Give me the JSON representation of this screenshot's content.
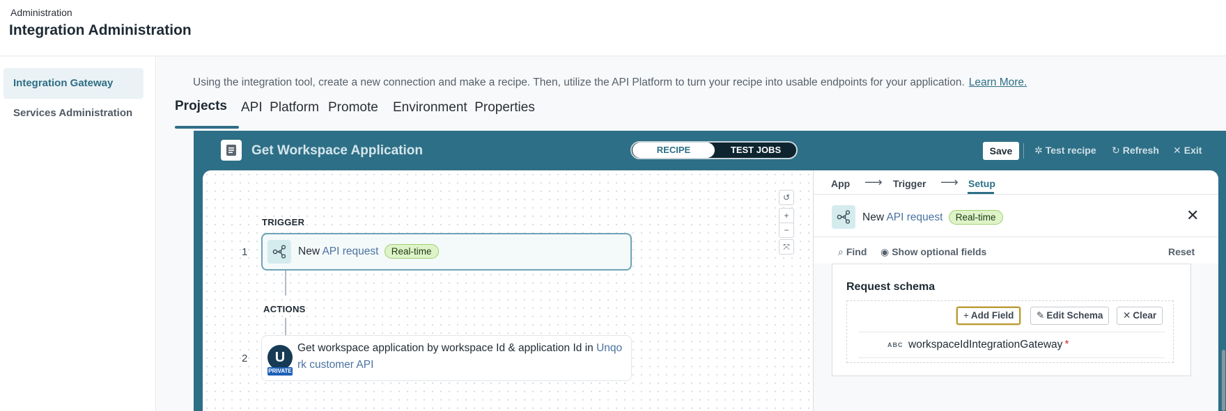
{
  "header": {
    "breadcrumb": "Administration",
    "title": "Integration Administration"
  },
  "sidebar": {
    "items": [
      {
        "label": "Integration Gateway",
        "active": true
      },
      {
        "label": "Services Administration",
        "active": false
      }
    ]
  },
  "main": {
    "info_text": "Using the integration tool, create a new connection and make a recipe. Then, utilize the API Platform to turn your recipe into usable endpoints for your application.",
    "learn_more": "Learn More.",
    "tabs": [
      {
        "label": "Projects",
        "active": true
      },
      {
        "label": "API  Platform",
        "active": false
      },
      {
        "label": "Promote",
        "active": false
      },
      {
        "label": "Environment  Properties",
        "active": false
      }
    ]
  },
  "recipe": {
    "title": "Get Workspace Application",
    "toggle": {
      "recipe": "RECIPE",
      "test_jobs": "TEST JOBS"
    },
    "actions": {
      "save": "Save",
      "test_recipe": "Test recipe",
      "refresh": "Refresh",
      "exit": "Exit"
    }
  },
  "canvas": {
    "trigger_label": "TRIGGER",
    "actions_label": "ACTIONS",
    "steps": [
      {
        "num": "1",
        "prefix": "New",
        "link": "API request",
        "badge": "Real-time"
      },
      {
        "num": "2",
        "text": "Get workspace application by workspace Id & application Id in",
        "link_line1": "Unqo",
        "link_line2": "rk customer API",
        "avatar": "U",
        "tag": "PRIVATE"
      }
    ],
    "controls": {
      "reset": "↺",
      "zoom_in": "+",
      "zoom_out": "−",
      "fit": "⤧"
    }
  },
  "panel": {
    "steps": [
      "App",
      "Trigger",
      "Setup"
    ],
    "active_step": "Setup",
    "heading": {
      "prefix": "New",
      "link": "API request",
      "badge": "Real-time"
    },
    "find": "Find",
    "show_optional": "Show optional fields",
    "reset": "Reset",
    "schema": {
      "title": "Request schema",
      "add_field": "Add Field",
      "edit_schema": "Edit Schema",
      "clear": "Clear",
      "field_type": "ABC",
      "field_name": "workspaceIdIntegrationGateway",
      "required_mark": "*"
    }
  },
  "colors": {
    "accent": "#2d6f86",
    "badge_bg": "#dff3c8",
    "link": "#4a72a0",
    "required": "#d12b2b"
  }
}
